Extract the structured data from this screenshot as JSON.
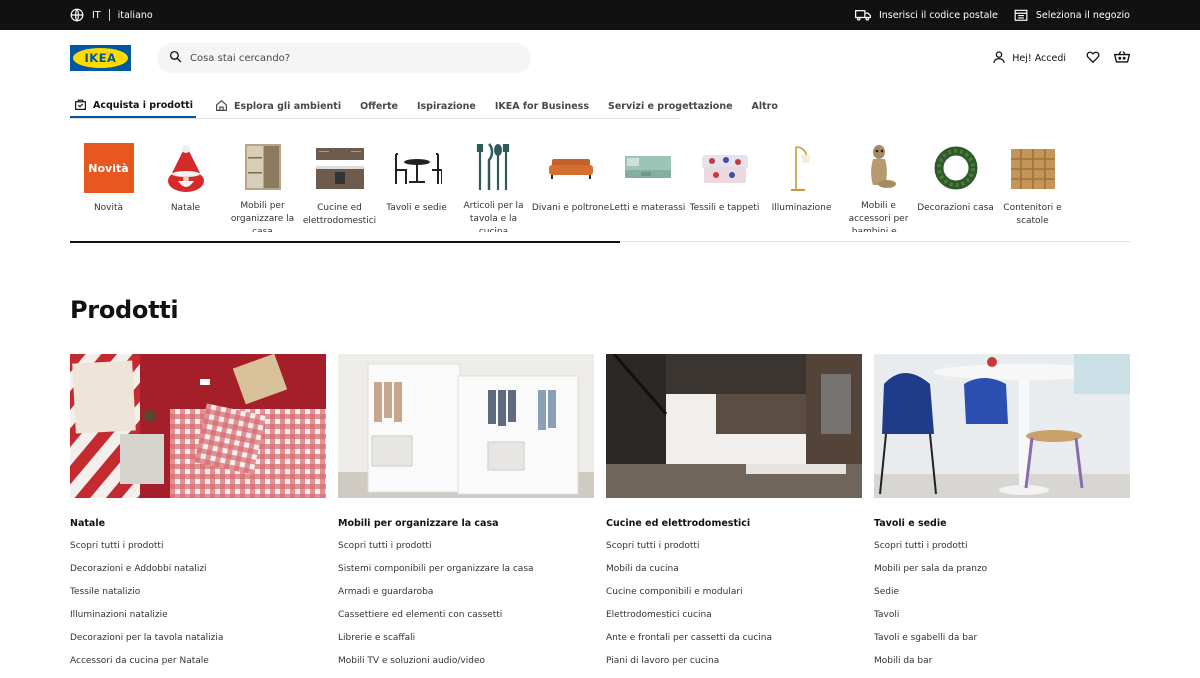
{
  "topbar": {
    "lang_code": "IT",
    "lang_name": "italiano",
    "postal_label": "Inserisci il codice postale",
    "store_label": "Seleziona il negozio"
  },
  "header": {
    "logo_text": "IKEA",
    "search_placeholder": "Cosa stai cercando?",
    "login_label": "Hej! Accedi"
  },
  "nav": {
    "tabs": [
      {
        "label": "Acquista i prodotti"
      },
      {
        "label": "Esplora gli ambienti"
      },
      {
        "label": "Offerte"
      },
      {
        "label": "Ispirazione"
      },
      {
        "label": "IKEA for Business"
      },
      {
        "label": "Servizi e progettazione"
      },
      {
        "label": "Altro"
      }
    ]
  },
  "categories": [
    {
      "label": "Novità",
      "badge": "Novità"
    },
    {
      "label": "Natale"
    },
    {
      "label": "Mobili per organizzare la casa"
    },
    {
      "label": "Cucine ed elettrodomestici"
    },
    {
      "label": "Tavoli e sedie"
    },
    {
      "label": "Articoli per la tavola e la cucina"
    },
    {
      "label": "Divani e poltrone"
    },
    {
      "label": "Letti e materassi"
    },
    {
      "label": "Tessili e tappeti"
    },
    {
      "label": "Illuminazione"
    },
    {
      "label": "Mobili e accessori per bambini e..."
    },
    {
      "label": "Decorazioni casa"
    },
    {
      "label": "Contenitori e scatole"
    }
  ],
  "main": {
    "title": "Prodotti",
    "columns": [
      {
        "heading": "Natale",
        "links": [
          "Scopri tutti i prodotti",
          "Decorazioni e Addobbi natalizi",
          "Tessile natalizio",
          "Illuminazioni natalizie",
          "Decorazioni per la tavola natalizia",
          "Accessori da cucina per Natale"
        ]
      },
      {
        "heading": "Mobili per organizzare la casa",
        "links": [
          "Scopri tutti i prodotti",
          "Sistemi componibili per organizzare la casa",
          "Armadi e guardaroba",
          "Cassettiere ed elementi con cassetti",
          "Librerie e scaffali",
          "Mobili TV e soluzioni audio/video"
        ]
      },
      {
        "heading": "Cucine ed elettrodomestici",
        "links": [
          "Scopri tutti i prodotti",
          "Mobili da cucina",
          "Cucine componibili e modulari",
          "Elettrodomestici cucina",
          "Ante e frontali per cassetti da cucina",
          "Piani di lavoro per cucina"
        ]
      },
      {
        "heading": "Tavoli e sedie",
        "links": [
          "Scopri tutti i prodotti",
          "Mobili per sala da pranzo",
          "Sedie",
          "Tavoli",
          "Tavoli e sgabelli da bar",
          "Mobili da bar"
        ]
      }
    ]
  },
  "colors": {
    "ikea_blue": "#0058a3",
    "ikea_yellow": "#ffdb00",
    "novita_orange": "#e8571d",
    "topbar_bg": "#111111"
  }
}
